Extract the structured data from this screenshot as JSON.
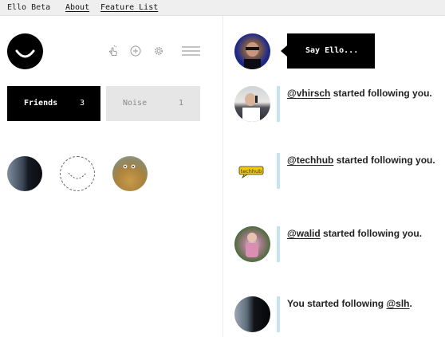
{
  "header": {
    "brand": "Ello Beta",
    "nav": [
      {
        "label": "About"
      },
      {
        "label": "Feature List"
      }
    ]
  },
  "logo": {
    "icon": "ello-smile-logo"
  },
  "toolbar": {
    "icons": [
      "hand-pointer-icon",
      "add-circle-icon",
      "gear-icon",
      "hamburger-menu-icon"
    ]
  },
  "tabs": [
    {
      "label": "Friends",
      "count": "3",
      "active": true
    },
    {
      "label": "Noise",
      "count": "1",
      "active": false
    }
  ],
  "friends": [
    {
      "icon": "user-avatar"
    },
    {
      "icon": "placeholder-smile-avatar"
    },
    {
      "icon": "user-avatar"
    }
  ],
  "say_ello": {
    "label": "Say Ello..."
  },
  "notifications": [
    {
      "handle": "@vhirsch",
      "text": " started following you."
    },
    {
      "handle": "@techhub",
      "text": " started following you."
    },
    {
      "handle": "@walid",
      "text": " started following you."
    },
    {
      "prefix": "You started following ",
      "handle": "@slh",
      "suffix": "."
    }
  ],
  "techhub_logo_text": "techhub",
  "colors": {
    "accent": "#000000",
    "topbar_bg": "#efefef",
    "notification_bar": "#c6e3f2",
    "inactive_tab_bg": "#e6e6e6"
  }
}
